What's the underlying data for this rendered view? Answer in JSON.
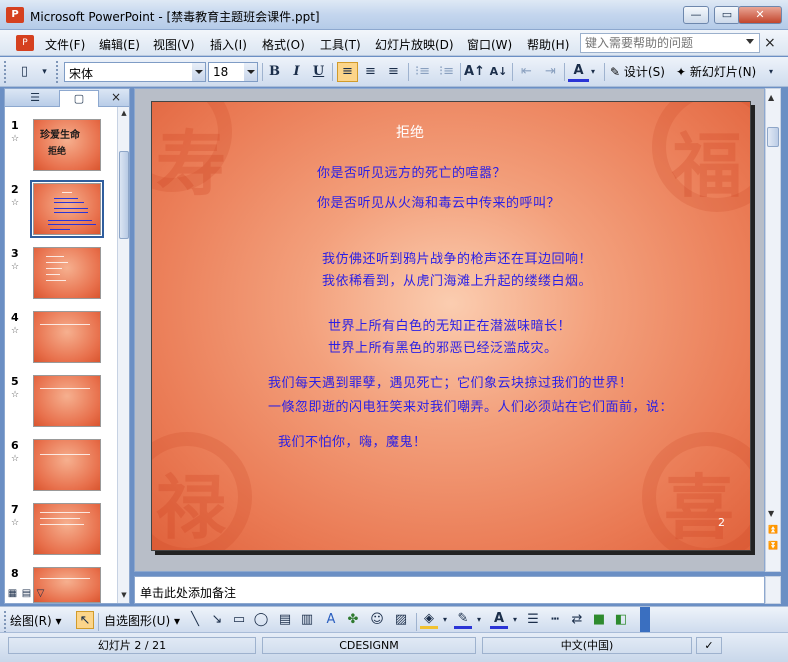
{
  "window": {
    "app_icon": "powerpoint-icon",
    "title": "Microsoft PowerPoint - [禁毒教育主题班会课件.ppt]",
    "controls": {
      "minimize": "—",
      "restore": "▭",
      "close": "✕"
    }
  },
  "menu": {
    "items": [
      "文件(F)",
      "编辑(E)",
      "视图(V)",
      "插入(I)",
      "格式(O)",
      "工具(T)",
      "幻灯片放映(D)",
      "窗口(W)",
      "帮助(H)"
    ],
    "help_placeholder": "键入需要帮助的问题",
    "close_doc": "×"
  },
  "toolbar": {
    "font_name": "宋体",
    "font_size": "18",
    "bold": "B",
    "italic": "I",
    "underline": "U",
    "design_label": "设计(S)",
    "new_slide_label": "新幻灯片(N)",
    "active_align": "align-left"
  },
  "thumbnails": {
    "tabs": [
      "☰",
      "▢"
    ],
    "close": "×",
    "items": [
      {
        "num": "1",
        "title1": "珍爱生命",
        "title2": "拒绝"
      },
      {
        "num": "2",
        "selected": true
      },
      {
        "num": "3"
      },
      {
        "num": "4"
      },
      {
        "num": "5"
      },
      {
        "num": "6"
      },
      {
        "num": "7"
      },
      {
        "num": "8"
      }
    ]
  },
  "slide": {
    "title": "拒绝",
    "lines": [
      "你是否听见远方的死亡的喧嚣？",
      "你是否听见从火海和毒云中传来的呼叫？",
      "我仿佛还听到鸦片战争的枪声还在耳边回响！",
      "我依稀看到，从虎门海滩上升起的缕缕白烟。",
      "世界上所有白色的无知正在潜滋味暗长！",
      "世界上所有黑色的邪恶已经泛滥成灾。",
      "我们每天遇到罪孽，遇见死亡；它们象云块掠过我们的世界！",
      "一倏忽即逝的闪电狂笑来对我们嘲弄。人们必须站在它们面前，说：",
      "我们不怕你，嗨，魔鬼！"
    ],
    "number": "2",
    "text_color": "#2a1fe6"
  },
  "notes": {
    "placeholder": "单击此处添加备注"
  },
  "drawing": {
    "draw_label": "绘图(R)",
    "autoshapes_label": "自选图形(U)"
  },
  "status": {
    "slide_info": "幻灯片 2 / 21",
    "design": "CDESIGNM",
    "language": "中文(中国)"
  }
}
